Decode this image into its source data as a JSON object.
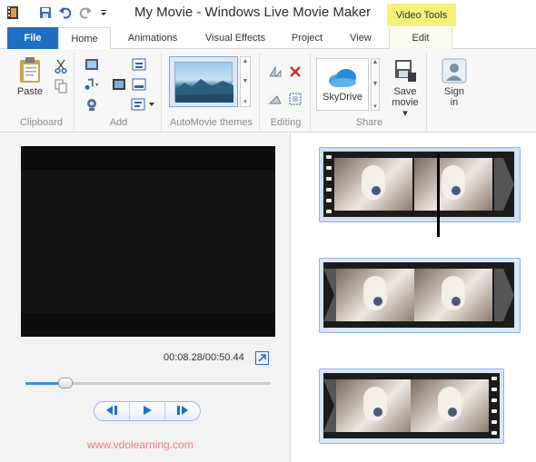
{
  "window": {
    "title": "My Movie - Windows Live Movie Maker"
  },
  "contextual_tab_group": "Video Tools",
  "tabs": {
    "file": "File",
    "home": "Home",
    "animations": "Animations",
    "visual_effects": "Visual Effects",
    "project": "Project",
    "view": "View",
    "edit": "Edit"
  },
  "ribbon": {
    "clipboard": {
      "label": "Clipboard",
      "paste": "Paste"
    },
    "add": {
      "label": "Add"
    },
    "automovie": {
      "label": "AutoMovie themes"
    },
    "editing": {
      "label": "Editing"
    },
    "share": {
      "label": "Share",
      "skydrive": "SkyDrive",
      "save_movie_line1": "Save",
      "save_movie_line2": "movie ▾"
    },
    "signin": {
      "line1": "Sign",
      "line2": "in"
    }
  },
  "player": {
    "time": "00:08.28/00:50.44",
    "progress": 0.164
  },
  "watermark": "www.vdolearning.com",
  "colors": {
    "accent": "#1f6fc5",
    "context_tab": "#f5f27a",
    "selection": "#d9e7f8"
  },
  "icons": [
    "app-icon",
    "save-icon",
    "undo-icon",
    "redo-icon",
    "paste-icon",
    "cut-icon",
    "copy-icon",
    "add-video-icon",
    "add-music-icon",
    "webcam-icon",
    "snapshot-icon",
    "title-icon",
    "caption-icon",
    "credits-icon",
    "rotate-left-icon",
    "rotate-right-icon",
    "remove-icon",
    "select-all-icon",
    "skydrive-icon",
    "save-movie-icon",
    "user-icon",
    "popout-icon",
    "previous-frame-icon",
    "play-icon",
    "next-frame-icon",
    "clock-icon"
  ]
}
